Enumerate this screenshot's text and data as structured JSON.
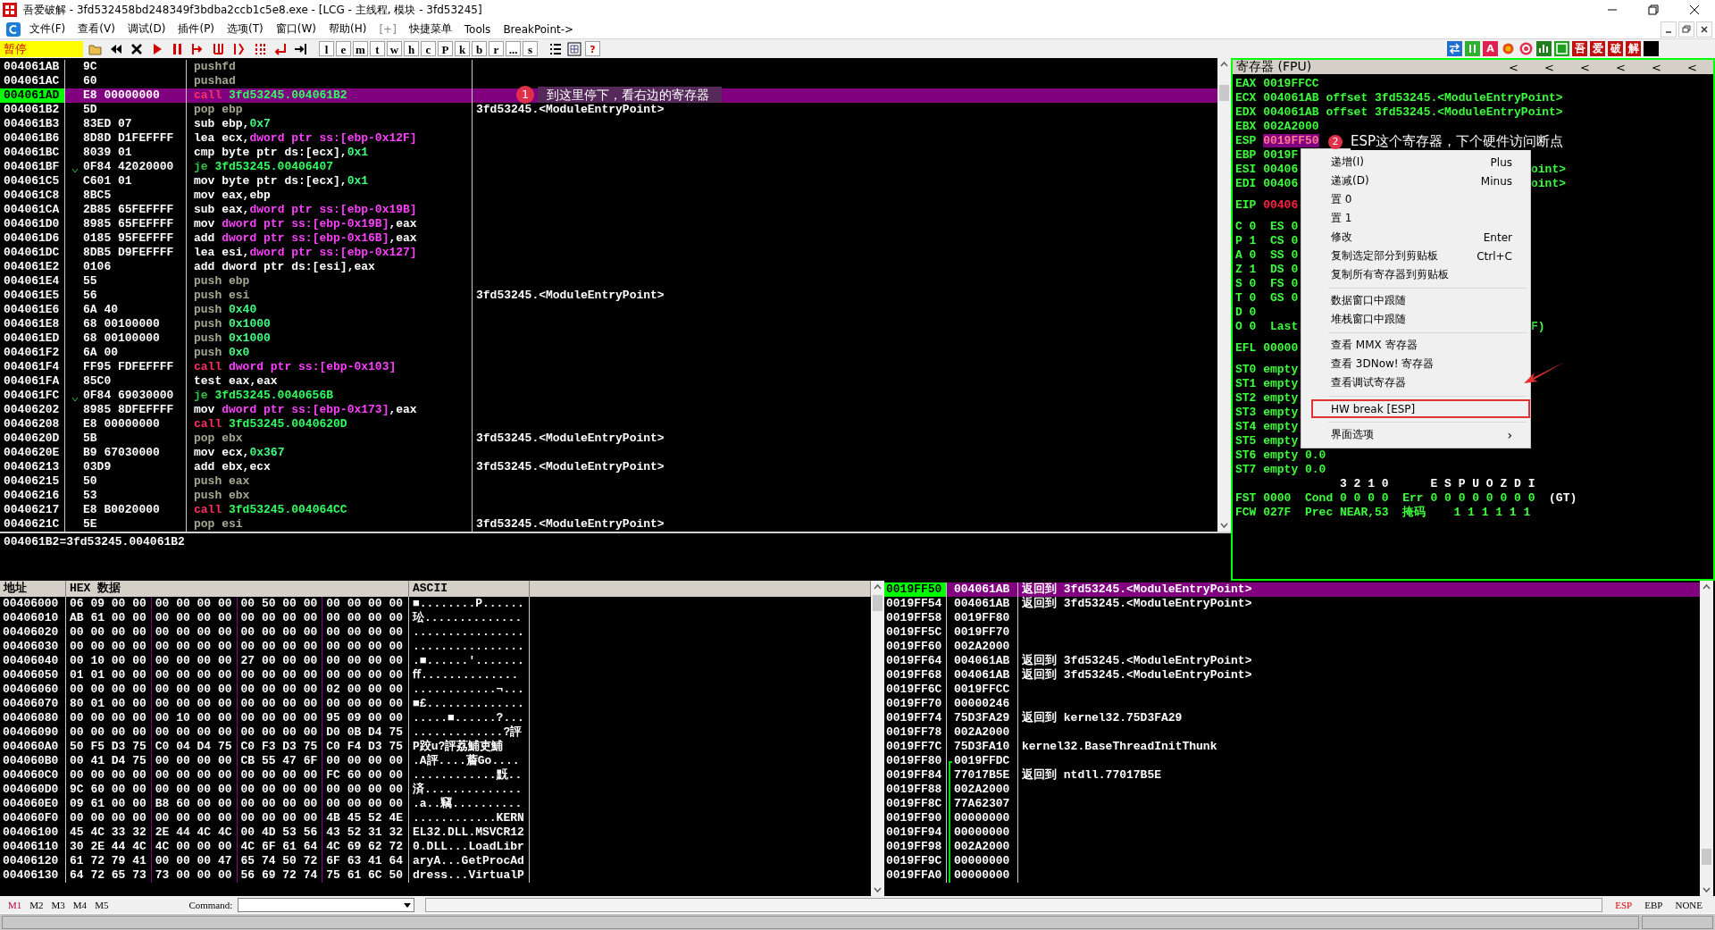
{
  "titlebar": {
    "title": "吾爱破解 - 3fd532458bd248349f3bdba2ccb1c5e8.exe - [LCG - 主线程, 模块 - 3fd53245]"
  },
  "menubar": {
    "items": [
      "文件(F)",
      "查看(V)",
      "调试(D)",
      "插件(P)",
      "选项(T)",
      "窗口(W)",
      "帮助(H)",
      "[+]",
      "快捷菜单",
      "Tools",
      "BreakPoint->"
    ]
  },
  "toolbar": {
    "status": "暂停",
    "letters": [
      "l",
      "e",
      "m",
      "t",
      "w",
      "h",
      "c",
      "P",
      "k",
      "b",
      "r",
      "...",
      "s"
    ],
    "help_key": "?",
    "plugin_key": "A",
    "brand_keys": [
      "吾",
      "爱",
      "破",
      "解"
    ]
  },
  "disassembly": {
    "rows": [
      {
        "address": "004061AB",
        "opcode": "9C",
        "parts": [
          {
            "kind": "stack",
            "text": "pushfd"
          }
        ],
        "selected": false
      },
      {
        "address": "004061AC",
        "opcode": "60",
        "parts": [
          {
            "kind": "stack",
            "text": "pushad"
          }
        ],
        "selected": false
      },
      {
        "address": "004061AD",
        "opcode": "E8 00000000",
        "parts": [
          {
            "kind": "call",
            "text": "call "
          },
          {
            "kind": "target",
            "text": "3fd53245.004061B2"
          }
        ],
        "selected": true
      },
      {
        "address": "004061B2",
        "opcode": "5D",
        "parts": [
          {
            "kind": "stack",
            "text": "pop ebp"
          }
        ],
        "comment": "3fd53245.<ModuleEntryPoint>",
        "selected": false
      },
      {
        "address": "004061B3",
        "opcode": "83ED 07",
        "parts": [
          {
            "kind": "plain",
            "text": "sub ebp,"
          },
          {
            "kind": "imm",
            "text": "0x7"
          }
        ],
        "selected": false
      },
      {
        "address": "004061B6",
        "opcode": "8D8D D1FEFFFF",
        "parts": [
          {
            "kind": "plain",
            "text": "lea ecx,"
          },
          {
            "kind": "mem",
            "text": "dword ptr ss:[ebp-0x12F]"
          }
        ],
        "selected": false
      },
      {
        "address": "004061BC",
        "opcode": "8039 01",
        "parts": [
          {
            "kind": "plain",
            "text": "cmp byte ptr ds:[ecx],"
          },
          {
            "kind": "imm",
            "text": "0x1"
          }
        ],
        "selected": false
      },
      {
        "address": "004061BF",
        "opcode": "0F84 42020000",
        "parts": [
          {
            "kind": "jump",
            "text": "je "
          },
          {
            "kind": "target",
            "text": "3fd53245.00406407"
          }
        ],
        "selected": false
      },
      {
        "address": "004061C5",
        "opcode": "C601 01",
        "parts": [
          {
            "kind": "plain",
            "text": "mov byte ptr ds:[ecx],"
          },
          {
            "kind": "imm",
            "text": "0x1"
          }
        ],
        "selected": false
      },
      {
        "address": "004061C8",
        "opcode": "8BC5",
        "parts": [
          {
            "kind": "plain",
            "text": "mov eax,ebp"
          }
        ],
        "selected": false
      },
      {
        "address": "004061CA",
        "opcode": "2B85 65FEFFFF",
        "parts": [
          {
            "kind": "plain",
            "text": "sub eax,"
          },
          {
            "kind": "mem",
            "text": "dword ptr ss:[ebp-0x19B]"
          }
        ],
        "selected": false
      },
      {
        "address": "004061D0",
        "opcode": "8985 65FEFFFF",
        "parts": [
          {
            "kind": "plain",
            "text": "mov "
          },
          {
            "kind": "mem",
            "text": "dword ptr ss:[ebp-0x19B]"
          },
          {
            "kind": "plain",
            "text": ",eax"
          }
        ],
        "selected": false
      },
      {
        "address": "004061D6",
        "opcode": "0185 95FEFFFF",
        "parts": [
          {
            "kind": "plain",
            "text": "add "
          },
          {
            "kind": "mem",
            "text": "dword ptr ss:[ebp-0x16B]"
          },
          {
            "kind": "plain",
            "text": ",eax"
          }
        ],
        "selected": false
      },
      {
        "address": "004061DC",
        "opcode": "8DB5 D9FEFFFF",
        "parts": [
          {
            "kind": "plain",
            "text": "lea esi,"
          },
          {
            "kind": "mem",
            "text": "dword ptr ss:[ebp-0x127]"
          }
        ],
        "selected": false
      },
      {
        "address": "004061E2",
        "opcode": "0106",
        "parts": [
          {
            "kind": "plain",
            "text": "add dword ptr ds:[esi],eax"
          }
        ],
        "selected": false
      },
      {
        "address": "004061E4",
        "opcode": "55",
        "parts": [
          {
            "kind": "stack",
            "text": "push ebp"
          }
        ],
        "selected": false
      },
      {
        "address": "004061E5",
        "opcode": "56",
        "parts": [
          {
            "kind": "stack",
            "text": "push esi"
          }
        ],
        "comment": "3fd53245.<ModuleEntryPoint>",
        "selected": false
      },
      {
        "address": "004061E6",
        "opcode": "6A 40",
        "parts": [
          {
            "kind": "stack",
            "text": "push "
          },
          {
            "kind": "imm",
            "text": "0x40"
          }
        ],
        "selected": false
      },
      {
        "address": "004061E8",
        "opcode": "68 00100000",
        "parts": [
          {
            "kind": "stack",
            "text": "push "
          },
          {
            "kind": "imm",
            "text": "0x1000"
          }
        ],
        "selected": false
      },
      {
        "address": "004061ED",
        "opcode": "68 00100000",
        "parts": [
          {
            "kind": "stack",
            "text": "push "
          },
          {
            "kind": "imm",
            "text": "0x1000"
          }
        ],
        "selected": false
      },
      {
        "address": "004061F2",
        "opcode": "6A 00",
        "parts": [
          {
            "kind": "stack",
            "text": "push "
          },
          {
            "kind": "imm",
            "text": "0x0"
          }
        ],
        "selected": false
      },
      {
        "address": "004061F4",
        "opcode": "FF95 FDFEFFFF",
        "parts": [
          {
            "kind": "call",
            "text": "call "
          },
          {
            "kind": "mem",
            "text": "dword ptr ss:[ebp-0x103]"
          }
        ],
        "selected": false
      },
      {
        "address": "004061FA",
        "opcode": "85C0",
        "parts": [
          {
            "kind": "plain",
            "text": "test eax,eax"
          }
        ],
        "selected": false
      },
      {
        "address": "004061FC",
        "opcode": "0F84 69030000",
        "parts": [
          {
            "kind": "jump",
            "text": "je "
          },
          {
            "kind": "target",
            "text": "3fd53245.0040656B"
          }
        ],
        "selected": false
      },
      {
        "address": "00406202",
        "opcode": "8985 8DFEFFFF",
        "parts": [
          {
            "kind": "plain",
            "text": "mov "
          },
          {
            "kind": "mem",
            "text": "dword ptr ss:[ebp-0x173]"
          },
          {
            "kind": "plain",
            "text": ",eax"
          }
        ],
        "selected": false
      },
      {
        "address": "00406208",
        "opcode": "E8 00000000",
        "parts": [
          {
            "kind": "call",
            "text": "call "
          },
          {
            "kind": "target",
            "text": "3fd53245.0040620D"
          }
        ],
        "selected": false
      },
      {
        "address": "0040620D",
        "opcode": "5B",
        "parts": [
          {
            "kind": "stack",
            "text": "pop ebx"
          }
        ],
        "comment": "3fd53245.<ModuleEntryPoint>",
        "selected": false
      },
      {
        "address": "0040620E",
        "opcode": "B9 67030000",
        "parts": [
          {
            "kind": "plain",
            "text": "mov ecx,"
          },
          {
            "kind": "imm",
            "text": "0x367"
          }
        ],
        "selected": false
      },
      {
        "address": "00406213",
        "opcode": "03D9",
        "parts": [
          {
            "kind": "plain",
            "text": "add ebx,ecx"
          }
        ],
        "comment": "3fd53245.<ModuleEntryPoint>",
        "selected": false
      },
      {
        "address": "00406215",
        "opcode": "50",
        "parts": [
          {
            "kind": "stack",
            "text": "push eax"
          }
        ],
        "selected": false
      },
      {
        "address": "00406216",
        "opcode": "53",
        "parts": [
          {
            "kind": "stack",
            "text": "push ebx"
          }
        ],
        "selected": false
      },
      {
        "address": "00406217",
        "opcode": "E8 B0020000",
        "parts": [
          {
            "kind": "call",
            "text": "call "
          },
          {
            "kind": "target",
            "text": "3fd53245.004064CC"
          }
        ],
        "selected": false
      },
      {
        "address": "0040621C",
        "opcode": "5E",
        "parts": [
          {
            "kind": "stack",
            "text": "pop esi"
          }
        ],
        "comment": "3fd53245.<ModuleEntryPoint>",
        "selected": false
      }
    ],
    "annotation": {
      "number": "1",
      "text": "到这里停下，看右边的寄存器"
    },
    "info_line": "004061B2=3fd53245.004061B2"
  },
  "registers": {
    "title": "寄存器 (FPU)",
    "nav_buttons": [
      "<",
      "<",
      "<",
      "<",
      "<",
      "<"
    ],
    "groups": [
      [
        {
          "parts": [
            {
              "kind": "reg",
              "text": "EAX 0019FFCC"
            }
          ]
        },
        {
          "parts": [
            {
              "kind": "reg",
              "text": "ECX 004061AB offset 3fd53245.<ModuleEntryPoint>"
            }
          ]
        },
        {
          "parts": [
            {
              "kind": "reg",
              "text": "EDX 004061AB offset 3fd53245.<ModuleEntryPoint>"
            }
          ]
        },
        {
          "parts": [
            {
              "kind": "reg",
              "text": "EBX 002A2000"
            }
          ]
        },
        {
          "parts": [
            {
              "kind": "reg",
              "text": "ESP "
            },
            {
              "kind": "selected",
              "text": "0019FF50"
            }
          ]
        },
        {
          "parts": [
            {
              "kind": "reg",
              "text": "EBP 0019F"
            }
          ]
        },
        {
          "parts": [
            {
              "kind": "reg",
              "text": "ESI 00406"
            }
          ],
          "right": "oint>"
        },
        {
          "parts": [
            {
              "kind": "reg",
              "text": "EDI 00406"
            }
          ],
          "right": "oint>"
        }
      ],
      [
        {
          "parts": [
            {
              "kind": "reg",
              "text": "EIP "
            },
            {
              "kind": "changed",
              "text": "00406"
            }
          ]
        }
      ],
      [
        {
          "parts": [
            {
              "kind": "reg",
              "text": "C 0  ES 0"
            }
          ]
        },
        {
          "parts": [
            {
              "kind": "reg",
              "text": "P 1  CS 0"
            }
          ]
        },
        {
          "parts": [
            {
              "kind": "reg",
              "text": "A 0  SS 0"
            }
          ]
        },
        {
          "parts": [
            {
              "kind": "reg",
              "text": "Z 1  DS 0"
            }
          ]
        },
        {
          "parts": [
            {
              "kind": "reg",
              "text": "S 0  FS 0"
            }
          ]
        },
        {
          "parts": [
            {
              "kind": "reg",
              "text": "T 0  GS 0"
            }
          ]
        },
        {
          "parts": [
            {
              "kind": "reg",
              "text": "D 0"
            }
          ]
        },
        {
          "parts": [
            {
              "kind": "reg",
              "text": "O 0  Last"
            }
          ],
          "right": "F)"
        }
      ],
      [
        {
          "parts": [
            {
              "kind": "reg",
              "text": "EFL 00000"
            }
          ]
        }
      ],
      [
        {
          "parts": [
            {
              "kind": "reg",
              "text": "ST0 empty"
            }
          ]
        },
        {
          "parts": [
            {
              "kind": "reg",
              "text": "ST1 empty"
            }
          ]
        },
        {
          "parts": [
            {
              "kind": "reg",
              "text": "ST2 empty"
            }
          ]
        },
        {
          "parts": [
            {
              "kind": "reg",
              "text": "ST3 empty"
            }
          ]
        },
        {
          "parts": [
            {
              "kind": "reg",
              "text": "ST4 empty"
            }
          ]
        },
        {
          "parts": [
            {
              "kind": "reg",
              "text": "ST5 empty"
            }
          ]
        },
        {
          "parts": [
            {
              "kind": "reg",
              "text": "ST6 empty 0.0"
            }
          ]
        },
        {
          "parts": [
            {
              "kind": "reg",
              "text": "ST7 empty 0.0"
            }
          ]
        },
        {
          "parts": [
            {
              "kind": "plain",
              "text": "               3 2 1 0      E S P U O Z D I"
            }
          ]
        },
        {
          "parts": [
            {
              "kind": "reg",
              "text": "FST 0000  Cond 0 0 0 0  Err 0 0 0 0 0 0 0 0  "
            },
            {
              "kind": "plain",
              "text": "(GT)"
            }
          ]
        },
        {
          "parts": [
            {
              "kind": "reg",
              "text": "FCW 027F  Prec NEAR,53  掩码    1 1 1 1 1 1"
            }
          ]
        }
      ]
    ],
    "annotation": {
      "number": "2",
      "text": "ESP这个寄存器，下个硬件访问断点"
    },
    "context_menu": {
      "items": [
        {
          "kind": "item",
          "label": "递增(I)",
          "shortcut": "Plus",
          "boxed": false
        },
        {
          "kind": "item",
          "label": "递减(D)",
          "shortcut": "Minus",
          "boxed": false
        },
        {
          "kind": "item",
          "label": "置 0",
          "boxed": false
        },
        {
          "kind": "item",
          "label": "置 1",
          "boxed": false
        },
        {
          "kind": "item",
          "label": "修改",
          "shortcut": "Enter",
          "boxed": false
        },
        {
          "kind": "item",
          "label": "复制选定部分到剪贴板",
          "shortcut": "Ctrl+C",
          "boxed": false
        },
        {
          "kind": "item",
          "label": "复制所有寄存器到剪贴板",
          "boxed": false
        },
        {
          "kind": "separator"
        },
        {
          "kind": "item",
          "label": "数据窗口中跟随",
          "boxed": false
        },
        {
          "kind": "item",
          "label": "堆栈窗口中跟随",
          "boxed": false
        },
        {
          "kind": "separator"
        },
        {
          "kind": "item",
          "label": "查看 MMX 寄存器",
          "boxed": false
        },
        {
          "kind": "item",
          "label": "查看 3DNow! 寄存器",
          "boxed": false
        },
        {
          "kind": "item",
          "label": "查看调试寄存器",
          "boxed": false
        },
        {
          "kind": "separator"
        },
        {
          "kind": "item",
          "label": "HW break [ESP]",
          "boxed": true
        },
        {
          "kind": "separator"
        },
        {
          "kind": "submenu",
          "label": "界面选项",
          "arrow": "›",
          "boxed": false
        }
      ]
    }
  },
  "dump": {
    "columns": [
      "地址",
      "HEX 数据",
      "ASCII"
    ],
    "rows": [
      {
        "address": "00406000",
        "hex": "06 09 00 00 00 00 00 00 00 50 00 00 00 00 00 00",
        "ascii": "■........P......"
      },
      {
        "address": "00406010",
        "hex": "AB 61 00 00 00 00 00 00 00 00 00 00 00 00 00 00",
        "ascii": "玜.............."
      },
      {
        "address": "00406020",
        "hex": "00 00 00 00 00 00 00 00 00 00 00 00 00 00 00 00",
        "ascii": "................"
      },
      {
        "address": "00406030",
        "hex": "00 00 00 00 00 00 00 00 00 00 00 00 00 00 00 00",
        "ascii": "................"
      },
      {
        "address": "00406040",
        "hex": "00 10 00 00 00 00 00 00 27 00 00 00 00 00 00 00",
        "ascii": ".■......'......."
      },
      {
        "address": "00406050",
        "hex": "01 01 00 00 00 00 00 00 00 00 00 00 00 00 00 00",
        "ascii": "ﬀ.............."
      },
      {
        "address": "00406060",
        "hex": "00 00 00 00 00 00 00 00 00 00 00 00 02 00 00 00",
        "ascii": "............¬..."
      },
      {
        "address": "00406070",
        "hex": "80 01 00 00 00 00 00 00 00 00 00 00 00 00 00 00",
        "ascii": "■£.............."
      },
      {
        "address": "00406080",
        "hex": "00 00 00 00 00 10 00 00 00 00 00 00 95 09 00 00",
        "ascii": ".....■......?..."
      },
      {
        "address": "00406090",
        "hex": "00 00 00 00 00 00 00 00 00 00 00 00 D0 0B D4 75",
        "ascii": ".............?評"
      },
      {
        "address": "004060A0",
        "hex": "50 F5 D3 75 C0 04 D4 75 C0 F3 D3 75 C0 F4 D3 75",
        "ascii": "P跤u?評荔鯆吏鯆"
      },
      {
        "address": "004060B0",
        "hex": "00 41 D4 75 00 00 00 00 CB 55 47 6F 00 00 00 00",
        "ascii": ".A評....薝Go...."
      },
      {
        "address": "004060C0",
        "hex": "00 00 00 00 00 00 00 00 00 00 00 00 FC 60 00 00",
        "ascii": "............黖.."
      },
      {
        "address": "004060D0",
        "hex": "9C 60 00 00 00 00 00 00 00 00 00 00 00 00 00 00",
        "ascii": "済.............."
      },
      {
        "address": "004060E0",
        "hex": "09 61 00 00 B8 60 00 00 00 00 00 00 00 00 00 00",
        "ascii": ".a..竊.........."
      },
      {
        "address": "004060F0",
        "hex": "00 00 00 00 00 00 00 00 00 00 00 00 4B 45 52 4E",
        "ascii": "............KERN"
      },
      {
        "address": "00406100",
        "hex": "45 4C 33 32 2E 44 4C 4C 00 4D 53 56 43 52 31 32",
        "ascii": "EL32.DLL.MSVCR12"
      },
      {
        "address": "00406110",
        "hex": "30 2E 44 4C 4C 00 00 00 4C 6F 61 64 4C 69 62 72",
        "ascii": "0.DLL...LoadLibr"
      },
      {
        "address": "00406120",
        "hex": "61 72 79 41 00 00 00 47 65 74 50 72 6F 63 41 64",
        "ascii": "aryA...GetProcAd"
      },
      {
        "address": "00406130",
        "hex": "64 72 65 73 73 00 00 00 56 69 72 74 75 61 6C 50",
        "ascii": "dress...VirtualP"
      }
    ]
  },
  "stack": {
    "rows": [
      {
        "address": "0019FF50",
        "value": "004061AB",
        "comment": "返回到 3fd53245.<ModuleEntryPoint>",
        "selected": true,
        "frame": false
      },
      {
        "address": "0019FF54",
        "value": "004061AB",
        "comment": "返回到 3fd53245.<ModuleEntryPoint>",
        "selected": false,
        "frame": false
      },
      {
        "address": "0019FF58",
        "value": "0019FF80",
        "selected": false,
        "frame": false
      },
      {
        "address": "0019FF5C",
        "value": "0019FF70",
        "selected": false,
        "frame": false
      },
      {
        "address": "0019FF60",
        "value": "002A2000",
        "selected": false,
        "frame": false
      },
      {
        "address": "0019FF64",
        "value": "004061AB",
        "comment": "返回到 3fd53245.<ModuleEntryPoint>",
        "selected": false,
        "frame": false
      },
      {
        "address": "0019FF68",
        "value": "004061AB",
        "comment": "返回到 3fd53245.<ModuleEntryPoint>",
        "selected": false,
        "frame": false
      },
      {
        "address": "0019FF6C",
        "value": "0019FFCC",
        "selected": false,
        "frame": false
      },
      {
        "address": "0019FF70",
        "value": "00000246",
        "selected": false,
        "frame": false
      },
      {
        "address": "0019FF74",
        "value": "75D3FA29",
        "comment": "返回到 kernel32.75D3FA29",
        "selected": false,
        "frame": false
      },
      {
        "address": "0019FF78",
        "value": "002A2000",
        "selected": false,
        "frame": false
      },
      {
        "address": "0019FF7C",
        "value": "75D3FA10",
        "comment": "kernel32.BaseThreadInitThunk",
        "selected": false,
        "frame": false
      },
      {
        "address": "0019FF80",
        "value": "0019FFDC",
        "selected": false,
        "frame": true
      },
      {
        "address": "0019FF84",
        "value": "77017B5E",
        "comment": "返回到 ntdll.77017B5E",
        "selected": false,
        "frame": true
      },
      {
        "address": "0019FF88",
        "value": "002A2000",
        "selected": false,
        "frame": true
      },
      {
        "address": "0019FF8C",
        "value": "77A62307",
        "selected": false,
        "frame": true
      },
      {
        "address": "0019FF90",
        "value": "00000000",
        "selected": false,
        "frame": true
      },
      {
        "address": "0019FF94",
        "value": "00000000",
        "selected": false,
        "frame": true
      },
      {
        "address": "0019FF98",
        "value": "002A2000",
        "selected": false,
        "frame": true
      },
      {
        "address": "0019FF9C",
        "value": "00000000",
        "selected": false,
        "frame": true
      },
      {
        "address": "0019FFA0",
        "value": "00000000",
        "selected": false,
        "frame": true
      }
    ]
  },
  "bottom_bar": {
    "marks": [
      {
        "label": "M1",
        "selected": true
      },
      {
        "label": "M2",
        "selected": false
      },
      {
        "label": "M3",
        "selected": false
      },
      {
        "label": "M4",
        "selected": false
      },
      {
        "label": "M5",
        "selected": false
      }
    ],
    "command_label": "Command:",
    "bases": [
      {
        "label": "ESP",
        "selected": true
      },
      {
        "label": "EBP",
        "selected": false
      },
      {
        "label": "NONE",
        "selected": false
      }
    ]
  }
}
